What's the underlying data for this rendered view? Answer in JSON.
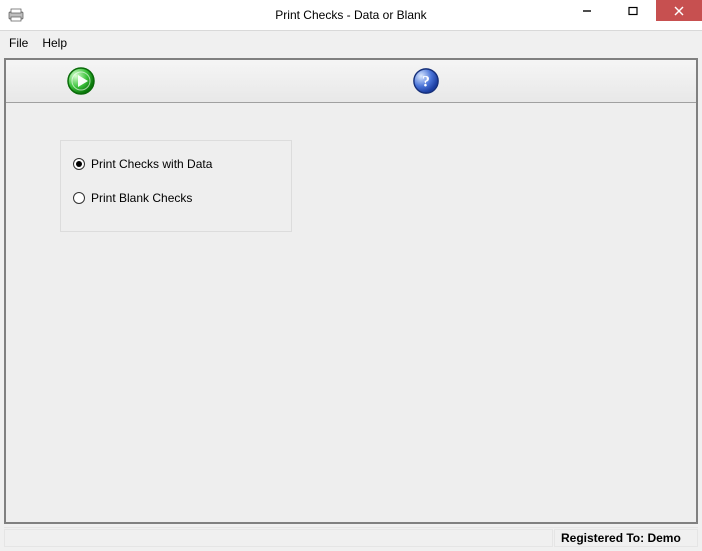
{
  "window": {
    "title": "Print Checks - Data or Blank"
  },
  "menu": {
    "file": "File",
    "help": "Help"
  },
  "options": {
    "with_data": "Print Checks with Data",
    "blank": "Print Blank Checks",
    "selected": "with_data"
  },
  "status": {
    "registered": "Registered To: Demo"
  },
  "icons": {
    "go": "play-icon",
    "help": "help-icon"
  }
}
